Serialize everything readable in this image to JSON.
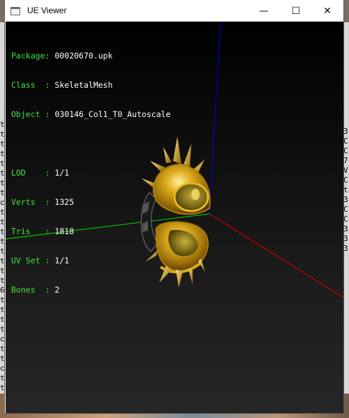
{
  "window": {
    "title": "UE Viewer",
    "minimize_glyph": "—",
    "maximize_glyph": "☐",
    "close_glyph": "✕"
  },
  "info": {
    "package_label": "Package: ",
    "package_value": "00020670.upk",
    "class_label": "Class  : ",
    "class_value": "SkeletalMesh",
    "object_label": "Object : ",
    "object_value": "030146_Col1_T0_Autoscale",
    "lod_label": "LOD    : ",
    "lod_value": "1/1",
    "verts_label": "Verts  : ",
    "verts_value": "1325",
    "tris_label": "Tris   : ",
    "tris_value": "1818",
    "uvset_label": "UV Set : ",
    "uvset_value": "1/1",
    "bones_label": "Bones  : ",
    "bones_value": "2"
  },
  "background": {
    "left_terminal_chars": "t\nt\nt\nt\nt\nt\nt\nt\nc\nt\nt\nt\nt\nt\nt\nt\nt\n6\nt\nt\nt\nt\nc\nt\nt\nc\nt\nt\nc\nc\nt\nt\nc\nc\nc\nc\nt",
    "right_terminal_chars": "3\nC\nC\n7\nV\nC\nt\n3\nC\nC\n3\n3\n3"
  },
  "colors": {
    "axis_x": "#c80000",
    "axis_y": "#00c800",
    "axis_z": "#0000d0",
    "label_key": "#3fe33f",
    "label_value": "#ffffff",
    "gold": "#d4a017"
  },
  "icons": [
    "app-window-icon",
    "minimize-icon",
    "maximize-icon",
    "close-icon"
  ]
}
